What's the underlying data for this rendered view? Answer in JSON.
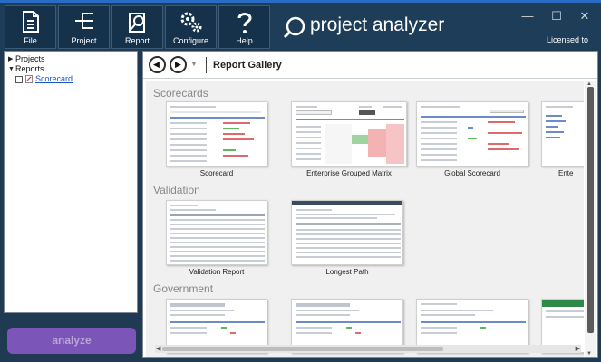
{
  "toolbar": {
    "buttons": [
      {
        "label": "File",
        "icon": "file-icon"
      },
      {
        "label": "Project",
        "icon": "project-icon"
      },
      {
        "label": "Report",
        "icon": "report-icon"
      },
      {
        "label": "Configure",
        "icon": "gears-icon"
      },
      {
        "label": "Help",
        "icon": "help-icon"
      }
    ]
  },
  "brand": {
    "name": "project analyzer"
  },
  "window": {
    "licensed": "Licensed to"
  },
  "tree": {
    "projects": "Projects",
    "reports": "Reports",
    "scorecard": "Scorecard"
  },
  "analyze_label": "analyze",
  "gallery": {
    "title": "Report Gallery",
    "sections": [
      {
        "name": "Scorecards",
        "items": [
          "Scorecard",
          "Enterprise Grouped Matrix",
          "Global Scorecard",
          "Ente"
        ]
      },
      {
        "name": "Validation",
        "items": [
          "Validation Report",
          "Longest Path"
        ]
      },
      {
        "name": "Government",
        "items": []
      }
    ]
  },
  "colors": {
    "accent": "#7b55b8",
    "topbar": "#1e3d58",
    "link": "#1a56c4"
  }
}
